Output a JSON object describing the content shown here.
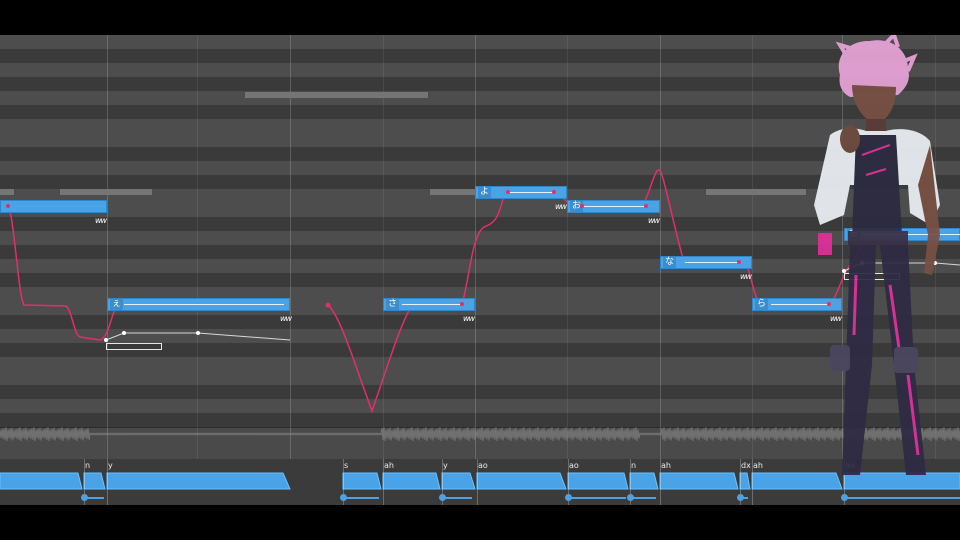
{
  "theme": {
    "note_color": "#4aa3e6",
    "pitch_curve_color": "#e0306a",
    "background": "#4a4a4a",
    "letterbox": "#000000"
  },
  "notes": [
    {
      "id": "n1",
      "lyric": "",
      "vib": "ww"
    },
    {
      "id": "n2",
      "lyric": "ぇ",
      "vib": "ww"
    },
    {
      "id": "n3",
      "lyric": "さ",
      "vib": "ww"
    },
    {
      "id": "n4",
      "lyric": "よ",
      "vib": "ww"
    },
    {
      "id": "n5",
      "lyric": "お",
      "vib": "ww"
    },
    {
      "id": "n6",
      "lyric": "な",
      "vib": "ww"
    },
    {
      "id": "n7",
      "lyric": "ら",
      "vib": "ww"
    },
    {
      "id": "n8",
      "lyric": "お",
      "vib": ""
    }
  ],
  "phonemes": [
    "n",
    "y",
    "s",
    "ah",
    "y",
    "ao",
    "ao",
    "n",
    "ah",
    "dx",
    "ah",
    "ao"
  ],
  "character": {
    "icon": "character-illustration",
    "hair_color": "#e8a4d8",
    "jacket_color": "#eceff4",
    "accent_color": "#e0309a"
  }
}
